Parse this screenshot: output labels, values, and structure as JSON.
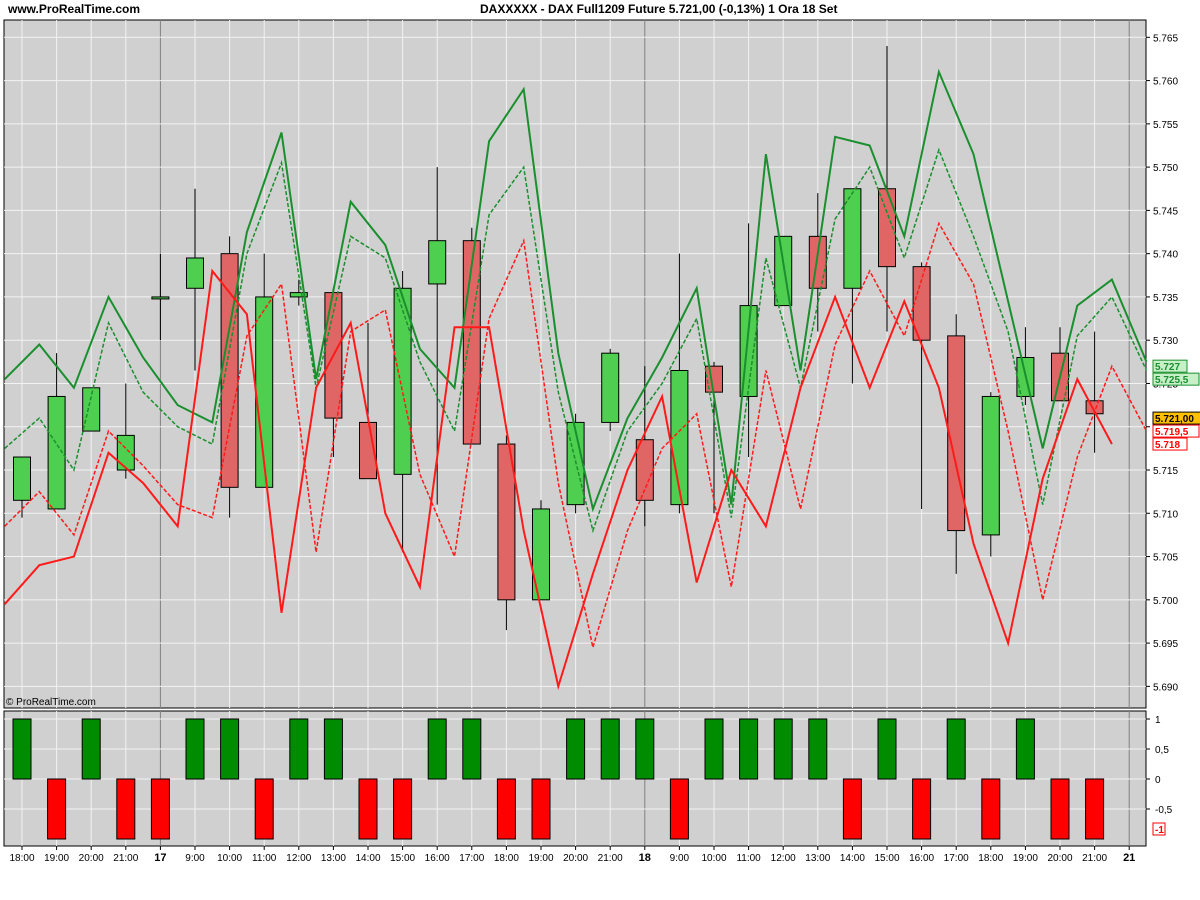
{
  "header": {
    "site": "www.ProRealTime.com",
    "title": "DAXXXXX - DAX Full1209 Future    5.721,00 (-0,13%)    1 Ora  18 Set"
  },
  "watermark": "© ProRealTime.com",
  "chart_data": [
    {
      "type": "candlestick",
      "ylim": [
        5.6875,
        5.767
      ],
      "yticks": [
        "5.690",
        "5.695",
        "5.700",
        "5.705",
        "5.710",
        "5.715",
        "5.720",
        "5.725",
        "5.730",
        "5.735",
        "5.740",
        "5.745",
        "5.750",
        "5.755",
        "5.760",
        "5.765"
      ],
      "grid": true,
      "candles": [
        {
          "o": 5.7115,
          "h": 5.7165,
          "l": 5.7095,
          "c": 5.7165
        },
        {
          "o": 5.7105,
          "h": 5.7285,
          "l": 5.7105,
          "c": 5.7235
        },
        {
          "o": 5.7195,
          "h": 5.7245,
          "l": 5.7195,
          "c": 5.7245
        },
        {
          "o": 5.715,
          "h": 5.725,
          "l": 5.714,
          "c": 5.719
        },
        {
          "o": 5.735,
          "h": 5.74,
          "l": 5.73,
          "c": 5.735
        },
        {
          "o": 5.736,
          "h": 5.7475,
          "l": 5.7265,
          "c": 5.7395
        },
        {
          "o": 5.74,
          "h": 5.742,
          "l": 5.7095,
          "c": 5.713
        },
        {
          "o": 5.713,
          "h": 5.74,
          "l": 5.713,
          "c": 5.735
        },
        {
          "o": 5.735,
          "h": 5.737,
          "l": 5.734,
          "c": 5.7355
        },
        {
          "o": 5.7355,
          "h": 5.736,
          "l": 5.7165,
          "c": 5.721
        },
        {
          "o": 5.7205,
          "h": 5.732,
          "l": 5.7145,
          "c": 5.714
        },
        {
          "o": 5.7145,
          "h": 5.738,
          "l": 5.7055,
          "c": 5.736
        },
        {
          "o": 5.7365,
          "h": 5.75,
          "l": 5.711,
          "c": 5.7415
        },
        {
          "o": 5.7415,
          "h": 5.743,
          "l": 5.718,
          "c": 5.718
        },
        {
          "o": 5.718,
          "h": 5.719,
          "l": 5.6965,
          "c": 5.7
        },
        {
          "o": 5.7,
          "h": 5.7115,
          "l": 5.7,
          "c": 5.7105
        },
        {
          "o": 5.711,
          "h": 5.7215,
          "l": 5.71,
          "c": 5.7205
        },
        {
          "o": 5.7205,
          "h": 5.729,
          "l": 5.7195,
          "c": 5.7285
        },
        {
          "o": 5.7185,
          "h": 5.727,
          "l": 5.7085,
          "c": 5.7115
        },
        {
          "o": 5.711,
          "h": 5.74,
          "l": 5.71,
          "c": 5.7265
        },
        {
          "o": 5.727,
          "h": 5.7275,
          "l": 5.71,
          "c": 5.724
        },
        {
          "o": 5.7235,
          "h": 5.7435,
          "l": 5.7165,
          "c": 5.734
        },
        {
          "o": 5.734,
          "h": 5.742,
          "l": 5.734,
          "c": 5.742
        },
        {
          "o": 5.742,
          "h": 5.747,
          "l": 5.731,
          "c": 5.736
        },
        {
          "o": 5.736,
          "h": 5.7475,
          "l": 5.725,
          "c": 5.7475
        },
        {
          "o": 5.7475,
          "h": 5.764,
          "l": 5.731,
          "c": 5.7385
        },
        {
          "o": 5.7385,
          "h": 5.739,
          "l": 5.7105,
          "c": 5.73
        },
        {
          "o": 5.7305,
          "h": 5.733,
          "l": 5.703,
          "c": 5.708
        },
        {
          "o": 5.7075,
          "h": 5.724,
          "l": 5.705,
          "c": 5.7235
        },
        {
          "o": 5.7235,
          "h": 5.7315,
          "l": 5.7225,
          "c": 5.728
        },
        {
          "o": 5.7285,
          "h": 5.7315,
          "l": 5.723,
          "c": 5.723
        },
        {
          "o": 5.723,
          "h": 5.731,
          "l": 5.717,
          "c": 5.7215
        }
      ],
      "series": [
        {
          "style": "solid",
          "color": "#1a8f2e",
          "values": [
            5.7255,
            5.7295,
            5.7245,
            5.735,
            5.728,
            5.7225,
            5.7205,
            5.7425,
            5.754,
            5.7255,
            5.746,
            5.741,
            5.729,
            5.7245,
            5.753,
            5.759,
            5.7285,
            5.7105,
            5.721,
            5.728,
            5.736,
            5.711,
            5.7515,
            5.7265,
            5.7535,
            5.7525,
            5.742,
            5.761,
            5.7515,
            5.7345,
            5.7175,
            5.734,
            5.737,
            5.7275
          ]
        },
        {
          "style": "dashed",
          "color": "#1a8f2e",
          "values": [
            5.7175,
            5.721,
            5.715,
            5.732,
            5.724,
            5.72,
            5.718,
            5.74,
            5.7505,
            5.7245,
            5.742,
            5.7395,
            5.7275,
            5.7195,
            5.7445,
            5.75,
            5.724,
            5.708,
            5.7195,
            5.725,
            5.7325,
            5.7095,
            5.7395,
            5.7245,
            5.744,
            5.75,
            5.7395,
            5.752,
            5.742,
            5.731,
            5.711,
            5.7305,
            5.735,
            5.7265
          ]
        },
        {
          "style": "dashed",
          "color": "#ff1a1a",
          "values": [
            5.7085,
            5.7125,
            5.7075,
            5.7195,
            5.7155,
            5.711,
            5.7095,
            5.7305,
            5.7365,
            5.7055,
            5.731,
            5.7335,
            5.7145,
            5.705,
            5.7325,
            5.7415,
            5.7135,
            5.6945,
            5.708,
            5.7175,
            5.7215,
            5.7015,
            5.7265,
            5.7105,
            5.7295,
            5.738,
            5.7305,
            5.7435,
            5.7365,
            5.7195,
            5.7,
            5.7165,
            5.727,
            5.7195
          ]
        },
        {
          "style": "solid",
          "color": "#ff1a1a",
          "values": [
            5.6995,
            5.704,
            5.705,
            5.717,
            5.7135,
            5.7085,
            5.738,
            5.733,
            5.6985,
            5.7245,
            5.732,
            5.71,
            5.7015,
            5.7315,
            5.7315,
            5.708,
            5.69,
            5.703,
            5.715,
            5.7235,
            5.702,
            5.715,
            5.7085,
            5.7245,
            5.735,
            5.7245,
            5.7345,
            5.7245,
            5.7065,
            5.695,
            5.714,
            5.7255,
            5.718
          ]
        }
      ],
      "price_labels": [
        {
          "text": "5.727",
          "value": 5.727,
          "color": "#1a8f2e",
          "bg": "#c8f0c8"
        },
        {
          "text": "5.725,5",
          "value": 5.7255,
          "color": "#1a8f2e",
          "bg": "#c8f0c8"
        },
        {
          "text": "5.721,00",
          "value": 5.721,
          "color": "#000000",
          "bg": "#ffc000"
        },
        {
          "text": "5.719,5",
          "value": 5.7195,
          "color": "#ff0000",
          "bg": "#ffffff"
        },
        {
          "text": "5.718",
          "value": 5.718,
          "color": "#ff0000",
          "bg": "#ffffff"
        }
      ],
      "colors": {
        "up": "#4fcf4f",
        "down": "#e06666",
        "panel": "#d0d0d0"
      }
    },
    {
      "type": "bar",
      "ylim": [
        -1,
        1
      ],
      "yticks": [
        "1",
        "0,5",
        "0",
        "-0,5"
      ],
      "last_label": "-1",
      "values": [
        1,
        -1,
        1,
        -1,
        -1,
        1,
        1,
        -1,
        1,
        1,
        -1,
        -1,
        1,
        1,
        -1,
        -1,
        1,
        1,
        1,
        -1,
        1,
        1,
        1,
        1,
        -1,
        1,
        -1,
        1,
        -1,
        1,
        -1,
        -1
      ],
      "colors": {
        "pos": "#008c00",
        "neg": "#ff0000"
      }
    }
  ],
  "x_axis": {
    "labels": [
      "18:00",
      "19:00",
      "20:00",
      "21:00",
      "17",
      "9:00",
      "10:00",
      "11:00",
      "12:00",
      "13:00",
      "14:00",
      "15:00",
      "16:00",
      "17:00",
      "18:00",
      "19:00",
      "20:00",
      "21:00",
      "18",
      "9:00",
      "10:00",
      "11:00",
      "12:00",
      "13:00",
      "14:00",
      "15:00",
      "16:00",
      "17:00",
      "18:00",
      "19:00",
      "20:00",
      "21:00",
      "21"
    ],
    "bold": [
      "17",
      "18",
      "21"
    ]
  }
}
